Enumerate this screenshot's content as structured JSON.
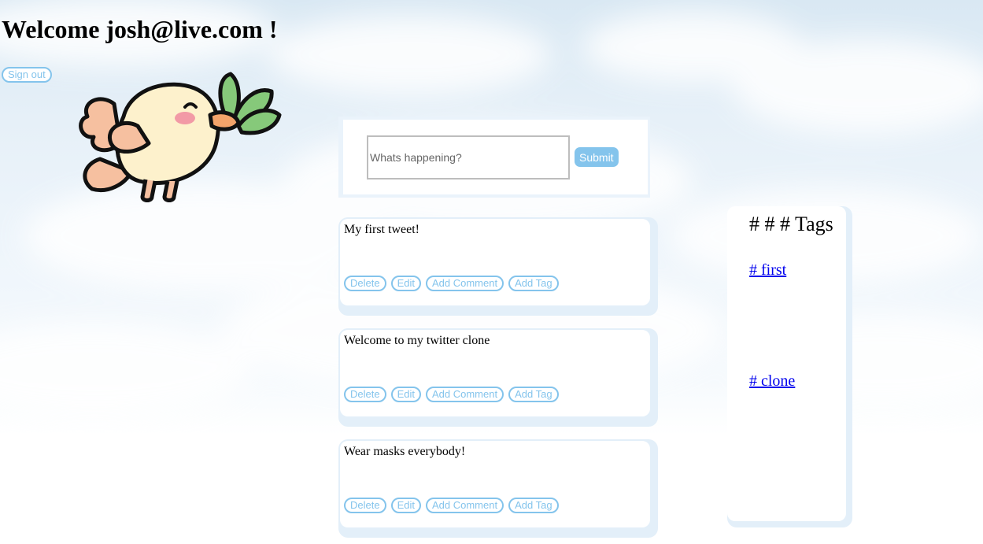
{
  "header": {
    "welcome_text": "Welcome josh@live.com !",
    "signout_label": "Sign out"
  },
  "compose": {
    "placeholder": "Whats happening?",
    "submit_label": "Submit"
  },
  "tweet_actions": {
    "delete_label": "Delete",
    "edit_label": "Edit",
    "comment_label": "Add Comment",
    "tag_label": "Add Tag"
  },
  "tweets": [
    {
      "text": "My first tweet!"
    },
    {
      "text": "Welcome to my twitter clone"
    },
    {
      "text": "Wear masks everybody!"
    }
  ],
  "tags": {
    "title": "# # # Tags",
    "items": [
      {
        "label": "# first"
      },
      {
        "label": "# clone"
      }
    ]
  },
  "colors": {
    "accent": "#84c4ec",
    "link": "#0000ee",
    "sky": "#e6f0f8"
  },
  "icons": {
    "mascot": "bird-mascot-icon"
  }
}
